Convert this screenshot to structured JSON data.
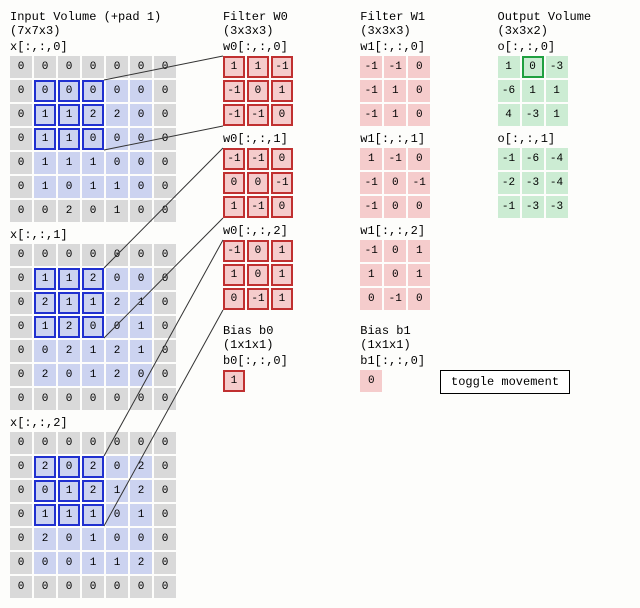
{
  "titles": {
    "input": "Input Volume (+pad 1) (7x7x3)",
    "w0": "Filter W0 (3x3x3)",
    "w1": "Filter W1 (3x3x3)",
    "out": "Output Volume (3x3x2)",
    "b0": "Bias b0 (1x1x1)",
    "b1": "Bias b1 (1x1x1)",
    "toggle": "toggle movement"
  },
  "labels": {
    "x0": "x[:,:,0]",
    "x1": "x[:,:,1]",
    "x2": "x[:,:,2]",
    "w00": "w0[:,:,0]",
    "w01": "w0[:,:,1]",
    "w02": "w0[:,:,2]",
    "w10": "w1[:,:,0]",
    "w11": "w1[:,:,1]",
    "w12": "w1[:,:,2]",
    "b00": "b0[:,:,0]",
    "b10": "b1[:,:,0]",
    "o0": "o[:,:,0]",
    "o1": "o[:,:,1]"
  },
  "input": {
    "x0": [
      [
        0,
        0,
        0,
        0,
        0,
        0,
        0
      ],
      [
        0,
        0,
        0,
        0,
        0,
        0,
        0
      ],
      [
        0,
        1,
        1,
        2,
        2,
        0,
        0
      ],
      [
        0,
        1,
        1,
        0,
        0,
        0,
        0
      ],
      [
        0,
        1,
        1,
        1,
        0,
        0,
        0
      ],
      [
        0,
        1,
        0,
        1,
        1,
        0,
        0
      ],
      [
        0,
        0,
        2,
        0,
        1,
        0,
        0
      ]
    ],
    "x1": [
      [
        0,
        0,
        0,
        0,
        0,
        0,
        0
      ],
      [
        0,
        1,
        1,
        2,
        0,
        0,
        0
      ],
      [
        0,
        2,
        1,
        1,
        2,
        1,
        0
      ],
      [
        0,
        1,
        2,
        0,
        0,
        1,
        0
      ],
      [
        0,
        0,
        2,
        1,
        2,
        1,
        0
      ],
      [
        0,
        2,
        0,
        1,
        2,
        0,
        0
      ],
      [
        0,
        0,
        0,
        0,
        0,
        0,
        0
      ]
    ],
    "x2": [
      [
        0,
        0,
        0,
        0,
        0,
        0,
        0
      ],
      [
        0,
        2,
        0,
        2,
        0,
        2,
        0
      ],
      [
        0,
        0,
        1,
        2,
        1,
        2,
        0
      ],
      [
        0,
        1,
        1,
        1,
        0,
        1,
        0
      ],
      [
        0,
        2,
        0,
        1,
        0,
        0,
        0
      ],
      [
        0,
        0,
        0,
        1,
        1,
        2,
        0
      ],
      [
        0,
        0,
        0,
        0,
        0,
        0,
        0
      ]
    ]
  },
  "w0": {
    "s0": [
      [
        1,
        1,
        -1
      ],
      [
        -1,
        0,
        1
      ],
      [
        -1,
        -1,
        0
      ]
    ],
    "s1": [
      [
        -1,
        -1,
        0
      ],
      [
        0,
        0,
        -1
      ],
      [
        1,
        -1,
        0
      ]
    ],
    "s2": [
      [
        -1,
        0,
        1
      ],
      [
        1,
        0,
        1
      ],
      [
        0,
        -1,
        1
      ]
    ]
  },
  "w1": {
    "s0": [
      [
        -1,
        -1,
        0
      ],
      [
        -1,
        1,
        0
      ],
      [
        -1,
        1,
        0
      ]
    ],
    "s1": [
      [
        1,
        -1,
        0
      ],
      [
        -1,
        0,
        -1
      ],
      [
        -1,
        0,
        0
      ]
    ],
    "s2": [
      [
        -1,
        0,
        1
      ],
      [
        1,
        0,
        1
      ],
      [
        0,
        -1,
        0
      ]
    ]
  },
  "b0": [
    [
      1
    ]
  ],
  "b1": [
    [
      0
    ]
  ],
  "out": {
    "o0": [
      [
        1,
        0,
        -3
      ],
      [
        -6,
        1,
        1
      ],
      [
        4,
        -3,
        1
      ]
    ],
    "o1": [
      [
        -1,
        -6,
        -4
      ],
      [
        -2,
        -3,
        -4
      ],
      [
        -1,
        -3,
        -3
      ]
    ]
  },
  "highlight": {
    "input_window": {
      "r": 1,
      "c": 1,
      "size": 3
    },
    "out_cell": {
      "r": 0,
      "c": 1
    }
  }
}
